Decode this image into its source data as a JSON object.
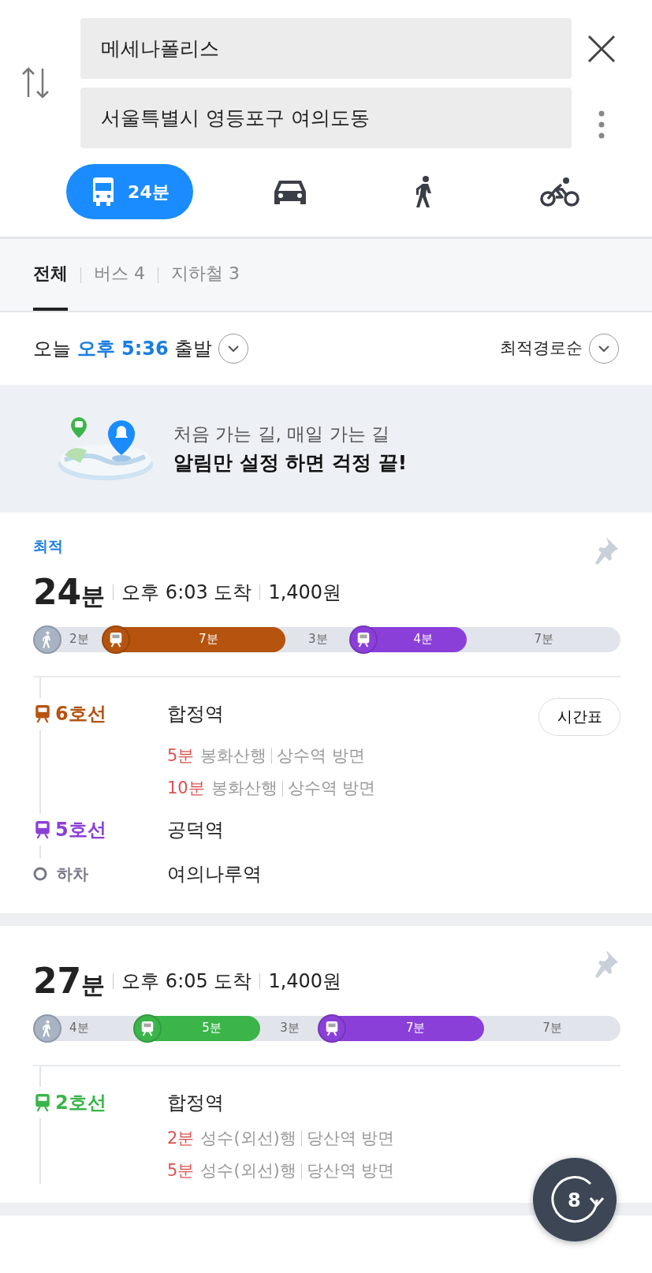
{
  "search": {
    "origin": "메세나폴리스",
    "destination": "서울특별시 영등포구 여의도동"
  },
  "modes": [
    {
      "kind": "bus",
      "label": "24분",
      "selected": true
    },
    {
      "kind": "car",
      "selected": false
    },
    {
      "kind": "walk",
      "selected": false
    },
    {
      "kind": "bike",
      "selected": false
    }
  ],
  "tabs": [
    {
      "label": "전체",
      "selected": true
    },
    {
      "label": "버스 4",
      "selected": false
    },
    {
      "label": "지하철 3",
      "selected": false
    }
  ],
  "departure": {
    "prefix": "오늘",
    "time": "오후 5:36",
    "suffix": "출발"
  },
  "sort": "최적경로순",
  "banner": {
    "line1": "처음 가는 길, 매일 가는 길",
    "line2": "알림만 설정 하면 걱정 끝!"
  },
  "routes": [
    {
      "tag": "최적",
      "duration": "24",
      "unit": "분",
      "arrival": "오후 6:03 도착",
      "fare": "1,400원",
      "segments": [
        {
          "kind": "walk",
          "label": "2분"
        },
        {
          "kind": "subway",
          "label": "7분",
          "color": "#b5530f"
        },
        {
          "kind": "walk",
          "label": "3분"
        },
        {
          "kind": "subway",
          "label": "4분",
          "color": "#8b3fd9"
        },
        {
          "kind": "walk",
          "label": "7분"
        }
      ],
      "legs": [
        {
          "kind": "subway",
          "line": "6호선",
          "color": "#b5530f",
          "station": "합정역",
          "timetable": "시간표",
          "arrivals": [
            {
              "wait": "5분",
              "dest": "봉화산행",
              "direction": "상수역 방면"
            },
            {
              "wait": "10분",
              "dest": "봉화산행",
              "direction": "상수역 방면"
            }
          ]
        },
        {
          "kind": "subway",
          "line": "5호선",
          "color": "#8b3fd9",
          "station": "공덕역"
        },
        {
          "kind": "exit",
          "line": "하차",
          "station": "여의나루역"
        }
      ]
    },
    {
      "duration": "27",
      "unit": "분",
      "arrival": "오후 6:05 도착",
      "fare": "1,400원",
      "segments": [
        {
          "kind": "walk",
          "label": "4분"
        },
        {
          "kind": "subway",
          "label": "5분",
          "color": "#3bb54a"
        },
        {
          "kind": "walk",
          "label": "3분"
        },
        {
          "kind": "subway",
          "label": "7분",
          "color": "#8b3fd9"
        },
        {
          "kind": "walk",
          "label": "7분"
        }
      ],
      "legs": [
        {
          "kind": "subway",
          "line": "2호선",
          "color": "#3bb54a",
          "station": "합정역",
          "arrivals": [
            {
              "wait": "2분",
              "dest": "성수(외선)행",
              "direction": "당산역 방면"
            },
            {
              "wait": "5분",
              "dest": "성수(외선)행",
              "direction": "당산역 방면"
            }
          ]
        }
      ]
    }
  ],
  "fab": {
    "count": "8"
  }
}
